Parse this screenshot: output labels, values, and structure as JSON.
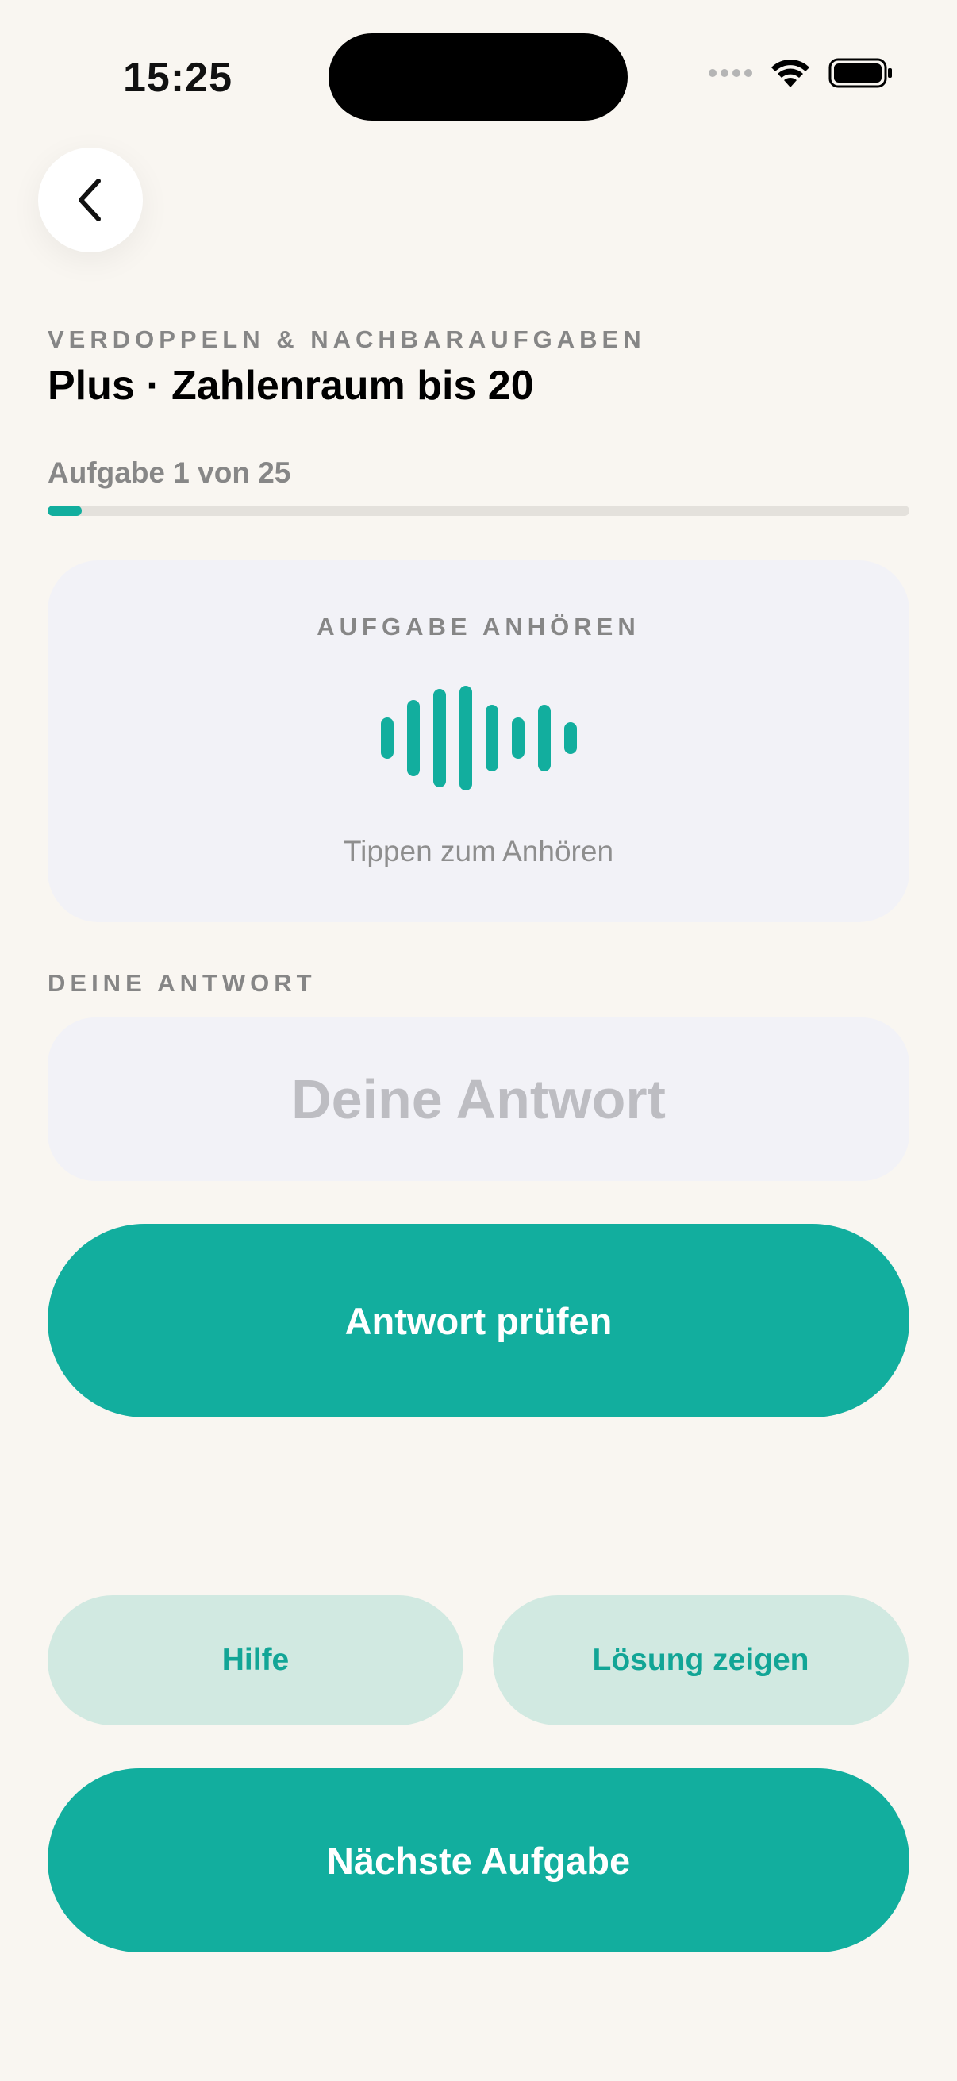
{
  "status_bar": {
    "time": "15:25"
  },
  "header": {
    "eyebrow": "VERDOPPELN & NACHBARAUFGABEN",
    "title": "Plus · Zahlenraum bis 20"
  },
  "progress": {
    "label": "Aufgabe 1 von 25",
    "current": 1,
    "total": 25,
    "color": "#12AE9E"
  },
  "listen_card": {
    "label": "AUFGABE ANHÖREN",
    "hint": "Tippen zum Anhören",
    "icon": "waveform-icon"
  },
  "answer": {
    "label": "DEINE ANTWORT",
    "placeholder": "Deine Antwort",
    "value": ""
  },
  "buttons": {
    "check": "Antwort prüfen",
    "help": "Hilfe",
    "show_solution": "Lösung zeigen",
    "next": "Nächste Aufgabe"
  },
  "colors": {
    "accent": "#12AE9E",
    "secondary_bg": "#D1E9E1",
    "background": "#F9F6F1",
    "card": "#F2F2F7"
  }
}
